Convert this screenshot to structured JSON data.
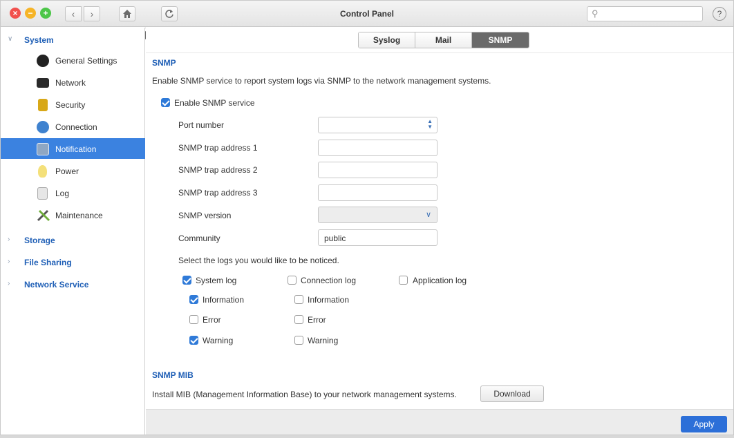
{
  "window": {
    "title": "Control Panel",
    "search_placeholder": ""
  },
  "toolbar": {
    "back": "‹",
    "forward": "›",
    "help": "?"
  },
  "sidebar": {
    "system": "System",
    "items": [
      {
        "label": "General Settings",
        "icon": "gear-icon"
      },
      {
        "label": "Network",
        "icon": "network-icon"
      },
      {
        "label": "Security",
        "icon": "lock-icon"
      },
      {
        "label": "Connection",
        "icon": "globe-icon"
      },
      {
        "label": "Notification",
        "icon": "notification-icon"
      },
      {
        "label": "Power",
        "icon": "lightbulb-icon"
      },
      {
        "label": "Log",
        "icon": "log-icon"
      },
      {
        "label": "Maintenance",
        "icon": "tools-icon"
      }
    ],
    "storage": "Storage",
    "file_sharing": "File Sharing",
    "network_service": "Network Service"
  },
  "tabs": [
    "Syslog",
    "Mail",
    "SNMP"
  ],
  "active_tab": "SNMP",
  "snmp": {
    "heading": "SNMP",
    "description": "Enable SNMP service to report system logs via SNMP to the network management systems.",
    "enable_label": "Enable SNMP service",
    "enable_checked": true,
    "port_label": "Port number",
    "port_value": "",
    "trap1_label": "SNMP trap address 1",
    "trap1_value": "",
    "trap2_label": "SNMP trap address 2",
    "trap2_value": "",
    "trap3_label": "SNMP trap address 3",
    "trap3_value": "",
    "version_label": "SNMP version",
    "version_value": "",
    "community_label": "Community",
    "community_value": "public",
    "logs_prompt": "Select the logs you would like to be noticed.",
    "system_log": "System log",
    "connection_log": "Connection log",
    "application_log": "Application log",
    "sys_information": "Information",
    "sys_error": "Error",
    "sys_warning": "Warning",
    "conn_information": "Information",
    "conn_error": "Error",
    "conn_warning": "Warning"
  },
  "mib": {
    "heading": "SNMP MIB",
    "description": "Install MIB (Management Information Base) to your network management systems.",
    "download": "Download"
  },
  "footer": {
    "apply": "Apply"
  },
  "colors": {
    "accent": "#2c6fd8",
    "sidebar_active": "#3b82e0",
    "heading": "#1f5fb6"
  }
}
